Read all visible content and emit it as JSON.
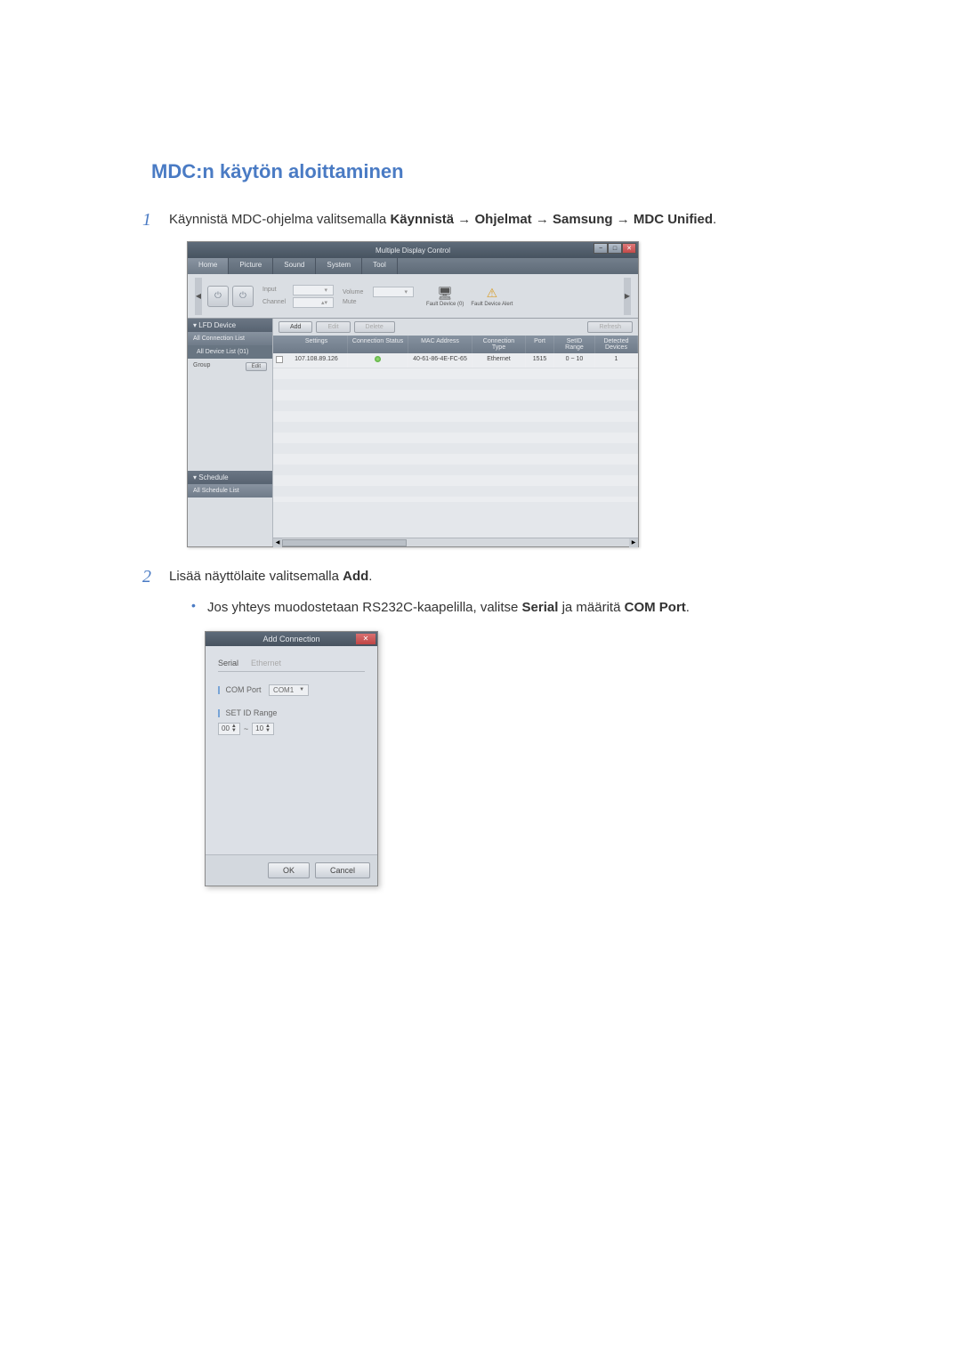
{
  "doc": {
    "title": "MDC:n käytön aloittaminen",
    "step1_num": "1",
    "step1_pre": "Käynnistä MDC-ohjelma valitsemalla ",
    "step1_path": [
      "Käynnistä",
      "Ohjelmat",
      "Samsung",
      "MDC Unified"
    ],
    "step1_sep": " → ",
    "step2_num": "2",
    "step2_pre": "Lisää näyttölaite valitsemalla ",
    "step2_bold": "Add",
    "step2_post": ".",
    "bullet_pre": "Jos yhteys muodostetaan RS232C-kaapelilla, valitse ",
    "bullet_b1": "Serial",
    "bullet_mid": " ja määritä ",
    "bullet_b2": "COM Port",
    "bullet_post": "."
  },
  "mdc": {
    "title": "Multiple Display Control",
    "help": "?",
    "menu": {
      "home": "Home",
      "picture": "Picture",
      "sound": "Sound",
      "system": "System",
      "tool": "Tool"
    },
    "toolbar": {
      "input_label": "Input",
      "channel_label": "Channel",
      "volume_label": "Volume",
      "mute_label": "Mute",
      "fault1": "Fault Device (0)",
      "fault2": "Fault Device Alert"
    },
    "side": {
      "lfd": "▾ LFD Device",
      "all_conn": "All Connection List",
      "all_dev": "All Device List (01)",
      "group": "Group",
      "edit": "Edit",
      "sched": "▾ Schedule",
      "all_sched": "All Schedule List"
    },
    "actions": {
      "add": "Add",
      "edit": "Edit",
      "delete": "Delete",
      "refresh": "Refresh"
    },
    "table": {
      "hdr": {
        "settings": "Settings",
        "conn": "Connection Status",
        "mac": "MAC Address",
        "type": "Connection Type",
        "port": "Port",
        "setid": "SetID Range",
        "detect": "Detected Devices"
      },
      "row": {
        "settings": "107.108.89.126",
        "mac": "40-61-86-4E-FC-65",
        "type": "Ethernet",
        "port": "1515",
        "setid": "0 ~ 10",
        "detect": "1"
      }
    }
  },
  "dialog": {
    "title": "Add Connection",
    "tab_serial": "Serial",
    "tab_eth": "Ethernet",
    "comport_label": "COM Port",
    "comport_value": "COM1",
    "setid_label": "SET ID Range",
    "range_from": "00",
    "range_sep": "~",
    "range_to": "10",
    "ok": "OK",
    "cancel": "Cancel"
  }
}
